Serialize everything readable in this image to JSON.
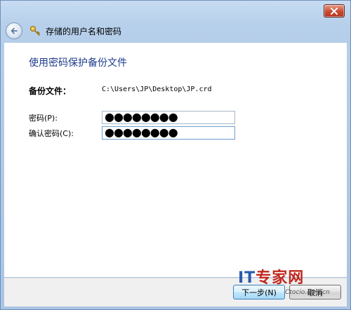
{
  "window": {
    "title": "存储的用户名和密码"
  },
  "page": {
    "heading": "使用密码保护备份文件",
    "backup_file_label": "备份文件：",
    "backup_file_path": "C:\\Users\\JP\\Desktop\\JP.crd",
    "password_label": "密码(P):",
    "password_value": "●●●●●●●●",
    "confirm_label": "确认密码(C):",
    "confirm_value": "●●●●●●●●"
  },
  "footer": {
    "next_button": "下一步(N)",
    "cancel_button": "取消"
  },
  "watermark": {
    "brand_it": "IT",
    "brand_rest": "专家网",
    "site": "Ctocio.com.cn"
  },
  "icons": {
    "close": "close-icon",
    "back": "back-arrow-icon",
    "title": "key-icon"
  },
  "colors": {
    "heading": "#1e3c8c",
    "close_button": "#c84a32",
    "watermark_blue": "#2a5caa",
    "watermark_red": "#c0281e"
  }
}
